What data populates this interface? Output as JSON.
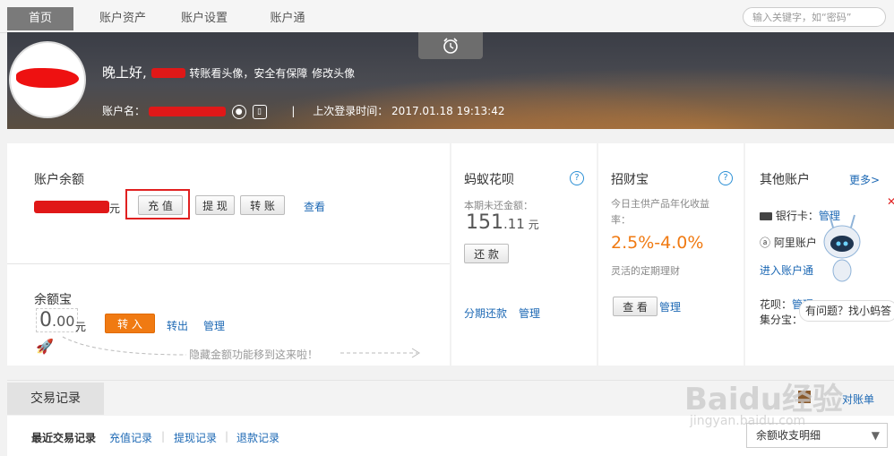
{
  "nav": {
    "tabs": [
      "首页",
      "账户资产",
      "账户设置",
      "账户通"
    ],
    "search_placeholder": "输入关键字，如“密码”"
  },
  "banner": {
    "greeting": "晚上好,",
    "hint_avatar": "转账看头像，安全有保障",
    "edit_avatar": "修改头像",
    "account_label": "账户名：",
    "separator": "|",
    "last_login_label": "上次登录时间：",
    "last_login_time": "2017.01.18 19:13:42"
  },
  "balance": {
    "title": "账户余额",
    "currency": "元",
    "recharge": "充 值",
    "withdraw": "提 现",
    "transfer": "转 账",
    "view": "查看"
  },
  "yuebao": {
    "title": "余额宝",
    "amount_int": "0",
    "amount_dec": ".00",
    "currency": "元",
    "transfer_in": "转 入",
    "transfer_out": "转出",
    "manage": "管理",
    "notice": "隐藏金额功能移到这来啦！"
  },
  "huabei": {
    "title": "蚂蚁花呗",
    "unpaid_label": "本期未还金额：",
    "amount_int": "151",
    "amount_dec": ".11",
    "currency": "元",
    "repay": "还 款",
    "installment": "分期还款",
    "manage": "管理"
  },
  "zhaocaibao": {
    "title": "招财宝",
    "desc": "今日主供产品年化收益率：",
    "rate": "2.5%-4.0%",
    "sub": "灵活的定期理财",
    "view": "查 看",
    "manage": "管理"
  },
  "other": {
    "title": "其他账户",
    "more": "更多>",
    "bank_card": "银行卡：",
    "manage": "管理",
    "alipay": "阿里账户",
    "enter": "进入账户通",
    "huabei_label": "花呗：",
    "huabei_manage": "管理",
    "jifen_label": "集分宝：",
    "assistant": "有问题？找小蚂答"
  },
  "records": {
    "tab": "交易记录",
    "reconcile": "对账单",
    "recent": "最近交易记录",
    "recharge": "充值记录",
    "withdraw": "提现记录",
    "refund": "退款记录",
    "filter": "余额收支明细"
  },
  "watermark": {
    "brand": "Baidu经验",
    "url": "jingyan.baidu.com"
  }
}
